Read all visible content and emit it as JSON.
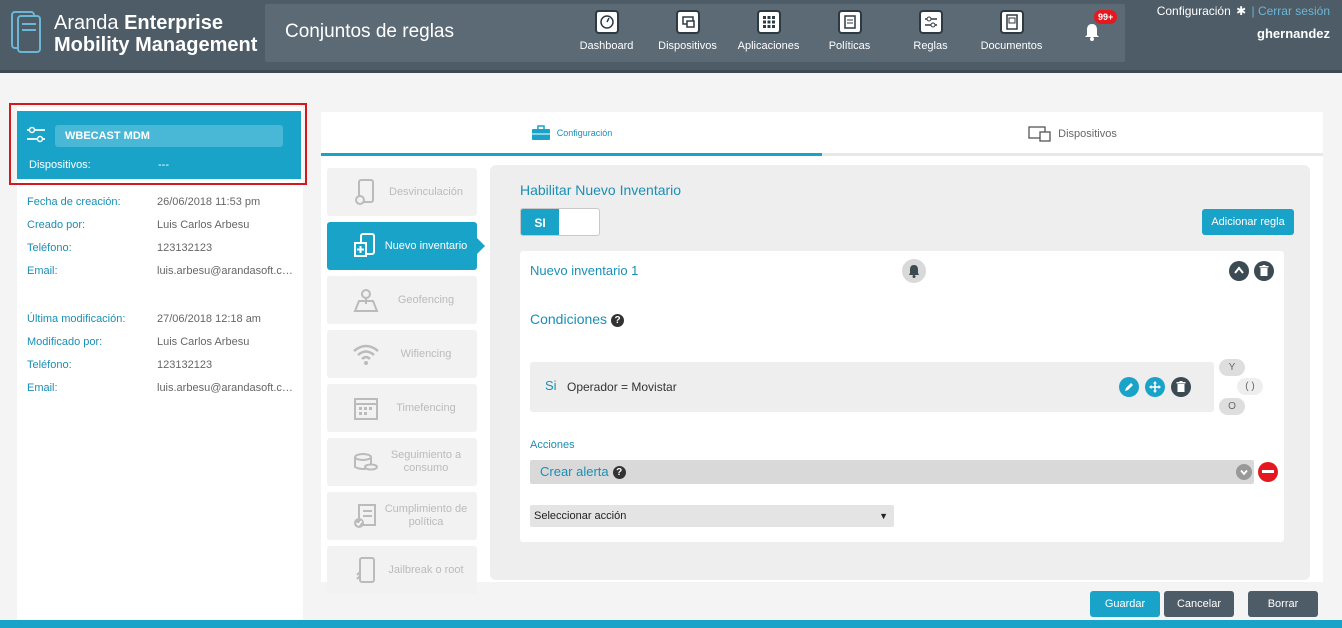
{
  "app": {
    "brand_light": "Aranda",
    "brand_bold_1": "Enterprise",
    "brand_line2": "Mobility Management",
    "page_title": "Conjuntos de reglas"
  },
  "nav": [
    {
      "label": "Dashboard",
      "icon": "dashboard-icon"
    },
    {
      "label": "Dispositivos",
      "icon": "devices-icon"
    },
    {
      "label": "Aplicaciones",
      "icon": "apps-grid-icon"
    },
    {
      "label": "Políticas",
      "icon": "policies-icon"
    },
    {
      "label": "Reglas",
      "icon": "rules-icon"
    },
    {
      "label": "Documentos",
      "icon": "documents-icon"
    }
  ],
  "notifications": {
    "badge": "99+"
  },
  "user": {
    "config_label": "Configuración",
    "logout_label": "| Cerrar sesión",
    "username": "ghernandez"
  },
  "rule_card": {
    "name": "WBECAST MDM",
    "devices_label": "Dispositivos:",
    "devices_value": "---"
  },
  "meta_created": [
    {
      "label": "Fecha de creación:",
      "value": "26/06/2018 11:53 pm"
    },
    {
      "label": "Creado por:",
      "value": "Luis Carlos Arbesu"
    },
    {
      "label": "Teléfono:",
      "value": "123132123"
    },
    {
      "label": "Email:",
      "value": "luis.arbesu@arandasoft.com"
    }
  ],
  "meta_modified": [
    {
      "label": "Última modificación:",
      "value": "27/06/2018 12:18 am"
    },
    {
      "label": "Modificado por:",
      "value": "Luis Carlos Arbesu"
    },
    {
      "label": "Teléfono:",
      "value": "123132123"
    },
    {
      "label": "Email:",
      "value": "luis.arbesu@arandasoft.com"
    }
  ],
  "tabs": {
    "config": "Configuración",
    "devices": "Dispositivos"
  },
  "menu": [
    {
      "label": "Desvinculación",
      "active": false
    },
    {
      "label": "Nuevo inventario",
      "active": true
    },
    {
      "label": "Geofencing",
      "active": false
    },
    {
      "label": "Wifiencing",
      "active": false
    },
    {
      "label": "Timefencing",
      "active": false
    },
    {
      "label": "Seguimiento a consumo",
      "active": false
    },
    {
      "label": "Cumplimiento de política",
      "active": false
    },
    {
      "label": "Jailbreak o root",
      "active": false
    }
  ],
  "content": {
    "section_title": "Habilitar Nuevo Inventario",
    "toggle_label": "SI",
    "add_rule_label": "Adicionar regla",
    "rule_title": "Nuevo inventario 1",
    "conditions_title": "Condiciones",
    "condition": {
      "prefix": "Si",
      "text": "Operador = Movistar"
    },
    "logic": {
      "and": "Y",
      "group": "( )",
      "or": "O"
    },
    "actions_title": "Acciones",
    "action_label": "Crear alerta",
    "select_placeholder": "Seleccionar acción"
  },
  "buttons": {
    "save": "Guardar",
    "cancel": "Cancelar",
    "delete": "Borrar"
  },
  "colors": {
    "accent": "#1aa3c8",
    "header": "#4d5c67",
    "danger": "#e4181e"
  }
}
